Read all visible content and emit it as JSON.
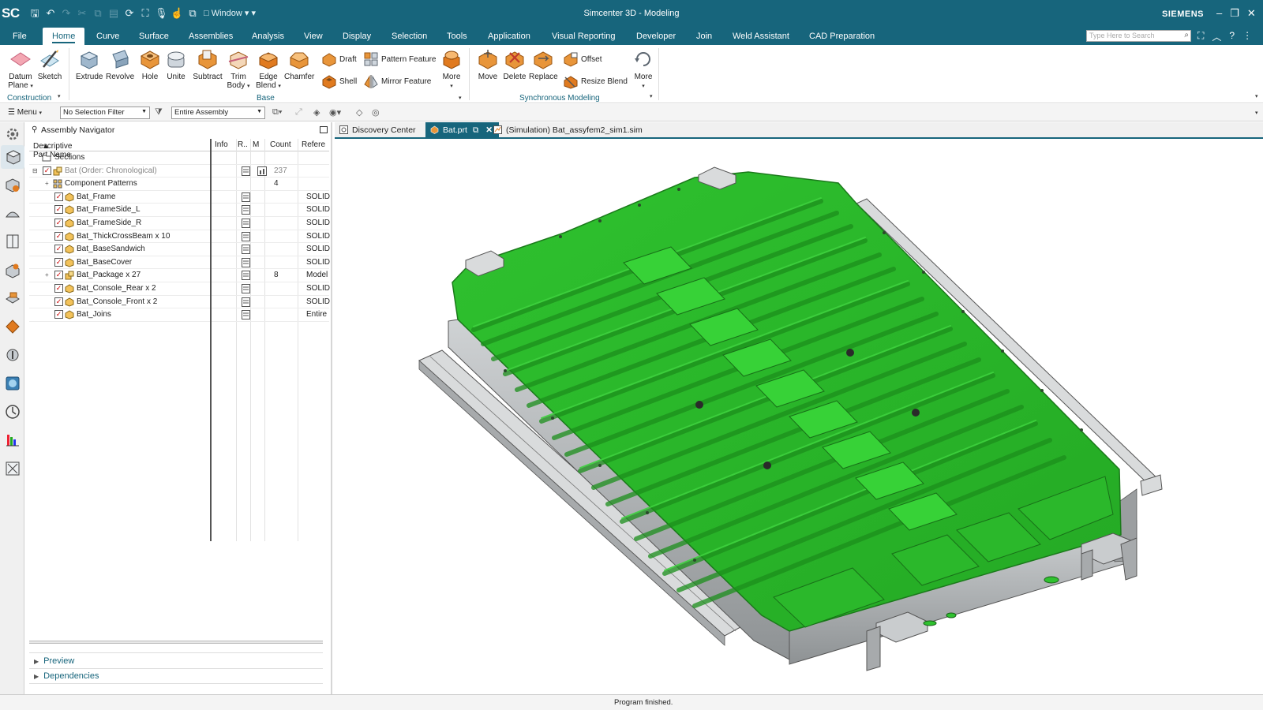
{
  "app": {
    "logo": "SC",
    "title": "Simcenter 3D - Modeling",
    "brand": "SIEMENS",
    "window_menu": "Window"
  },
  "menu": {
    "items": [
      "File",
      "Home",
      "Curve",
      "Surface",
      "Assemblies",
      "Analysis",
      "View",
      "Display",
      "Selection",
      "Tools",
      "Application",
      "Visual Reporting",
      "Developer",
      "Join",
      "Weld Assistant",
      "CAD Preparation"
    ],
    "active": "Home",
    "search_placeholder": "Type Here to Search"
  },
  "ribbon": {
    "construction": {
      "label": "Construction",
      "datum_plane": "Datum Plane",
      "sketch": "Sketch"
    },
    "base": {
      "label": "Base",
      "extrude": "Extrude",
      "revolve": "Revolve",
      "hole": "Hole",
      "unite": "Unite",
      "subtract": "Subtract",
      "trim_body": "Trim Body",
      "edge_blend": "Edge Blend",
      "chamfer": "Chamfer",
      "draft": "Draft",
      "shell": "Shell",
      "pattern_feature": "Pattern Feature",
      "mirror_feature": "Mirror Feature",
      "more": "More"
    },
    "sync": {
      "label": "Synchronous Modeling",
      "move": "Move",
      "delete": "Delete",
      "replace": "Replace",
      "offset": "Offset",
      "resize_blend": "Resize Blend",
      "more": "More"
    }
  },
  "selection_bar": {
    "menu": "Menu",
    "filter": "No Selection Filter",
    "scope": "Entire Assembly"
  },
  "navigator": {
    "title": "Assembly Navigator",
    "columns": {
      "name": "Descriptive Part Name",
      "info": "Info",
      "r": "R..",
      "m": "M",
      "count": "Count",
      "ref": "Refere"
    },
    "rows": [
      {
        "name": "Sections",
        "count": "",
        "ref": ""
      },
      {
        "name": "Bat (Order: Chronological)",
        "count": "237",
        "ref": ""
      },
      {
        "name": "Component Patterns",
        "count": "4",
        "ref": ""
      },
      {
        "name": "Bat_Frame",
        "count": "",
        "ref": "SOLID"
      },
      {
        "name": "Bat_FrameSide_L",
        "count": "",
        "ref": "SOLID"
      },
      {
        "name": "Bat_FrameSide_R",
        "count": "",
        "ref": "SOLID"
      },
      {
        "name": "Bat_ThickCrossBeam x 10",
        "count": "",
        "ref": "SOLID"
      },
      {
        "name": "Bat_BaseSandwich",
        "count": "",
        "ref": "SOLID"
      },
      {
        "name": "Bat_BaseCover",
        "count": "",
        "ref": "SOLID"
      },
      {
        "name": "Bat_Package x 27",
        "count": "8",
        "ref": "Model"
      },
      {
        "name": "Bat_Console_Rear x 2",
        "count": "",
        "ref": "SOLID"
      },
      {
        "name": "Bat_Console_Front x 2",
        "count": "",
        "ref": "SOLID"
      },
      {
        "name": "Bat_Joins",
        "count": "",
        "ref": "Entire"
      }
    ],
    "preview": "Preview",
    "dependencies": "Dependencies"
  },
  "tabs": [
    {
      "label": "Discovery Center"
    },
    {
      "label": "Bat.prt"
    },
    {
      "label": "(Simulation) Bat_assyfem2_sim1.sim"
    }
  ],
  "status": "Program finished.",
  "colors": {
    "accent": "#17657c",
    "model_green": "#2ec02e",
    "model_grey": "#b9bcbf"
  }
}
